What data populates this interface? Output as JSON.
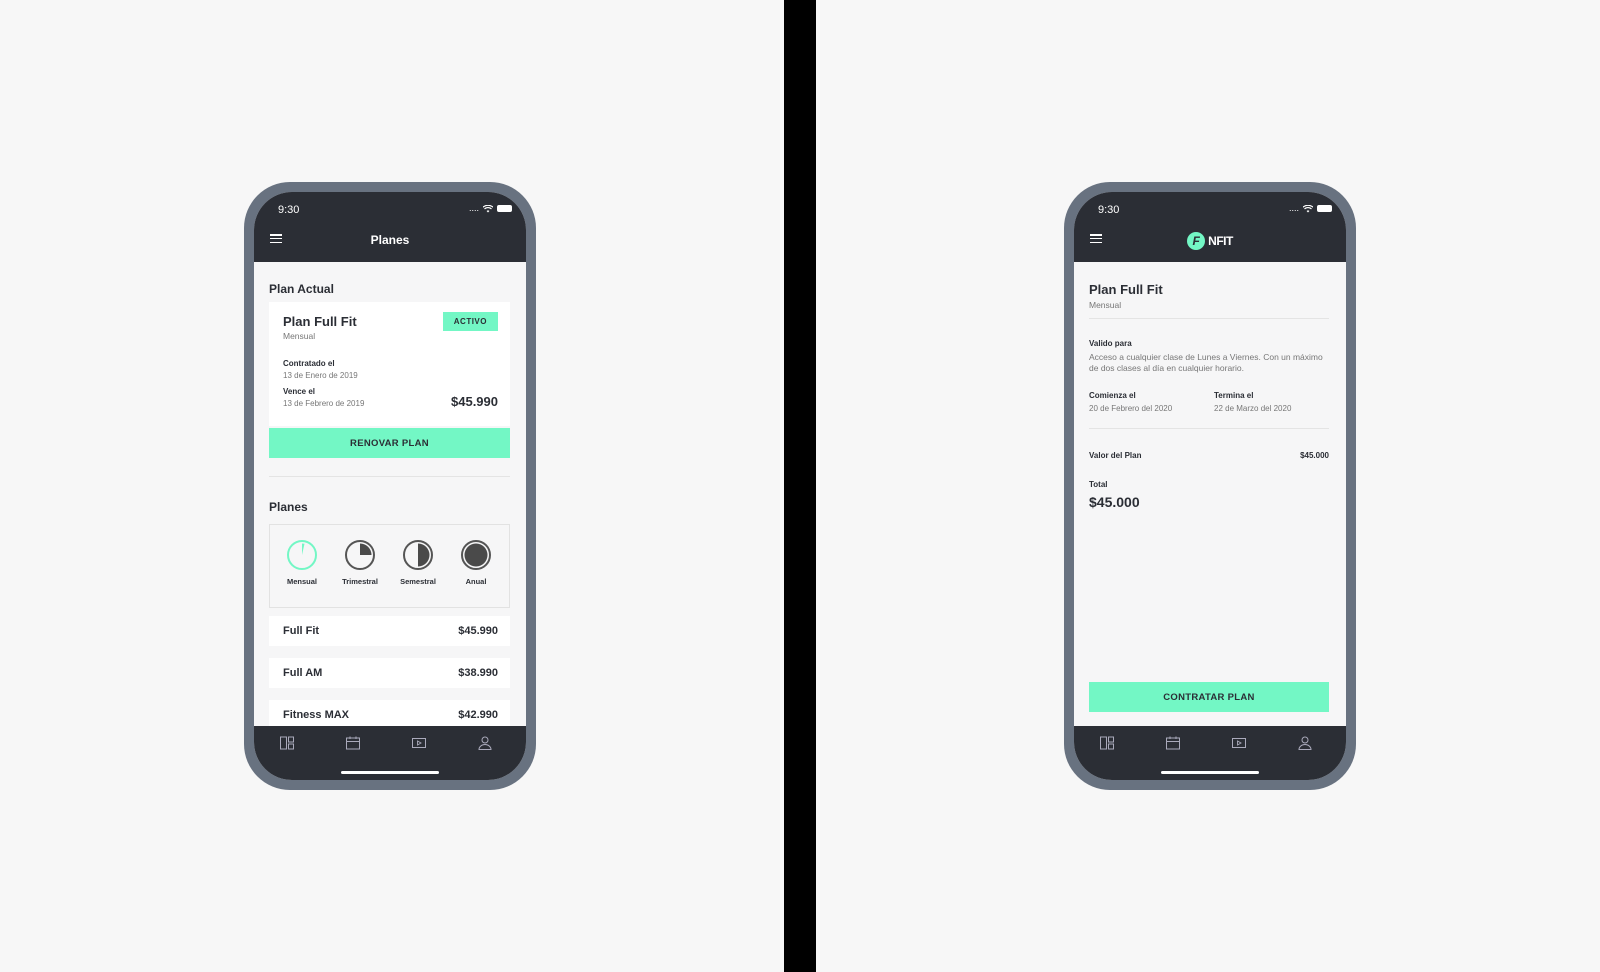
{
  "status": {
    "time": "9:30",
    "signal": "...."
  },
  "left": {
    "nav_title": "Planes",
    "current_section": "Plan Actual",
    "current_plan": {
      "name": "Plan Full Fit",
      "period": "Mensual",
      "badge": "ACTIVO",
      "contracted_label": "Contratado el",
      "contracted_date": "13 de Enero de 2019",
      "expires_label": "Vence el",
      "expires_date": "13 de Febrero de 2019",
      "price": "$45.990"
    },
    "renew_button": "RENOVAR PLAN",
    "plans_section": "Planes",
    "periods": [
      {
        "label": "Mensual",
        "icon": "pie-month-icon",
        "selected": true
      },
      {
        "label": "Trimestral",
        "icon": "pie-quarter-icon",
        "selected": false
      },
      {
        "label": "Semestral",
        "icon": "pie-half-icon",
        "selected": false
      },
      {
        "label": "Anual",
        "icon": "pie-full-icon",
        "selected": false
      }
    ],
    "plans": [
      {
        "name": "Full Fit",
        "price": "$45.990"
      },
      {
        "name": "Full AM",
        "price": "$38.990"
      },
      {
        "name": "Fitness MAX",
        "price": "$42.990"
      }
    ]
  },
  "right": {
    "brand": "NFIT",
    "brand_letter": "F",
    "plan_name": "Plan Full Fit",
    "period": "Mensual",
    "valid_label": "Valido para",
    "valid_text": "Acceso a cualquier clase de Lunes a Viernes. Con un máximo de dos clases al día en cualquier horario.",
    "start_label": "Comienza el",
    "start_date": "20 de Febrero del 2020",
    "end_label": "Termina el",
    "end_date": "22 de Marzo del 2020",
    "value_label": "Valor del Plan",
    "value": "$45.000",
    "total_label": "Total",
    "total": "$45.000",
    "contract_button": "CONTRATAR PLAN"
  },
  "tabs": [
    "dashboard-icon",
    "calendar-icon",
    "video-icon",
    "profile-icon"
  ],
  "colors": {
    "accent": "#73f7c5",
    "dark": "#2b2e35",
    "frame": "#687280",
    "background": "#f7f7f7"
  }
}
